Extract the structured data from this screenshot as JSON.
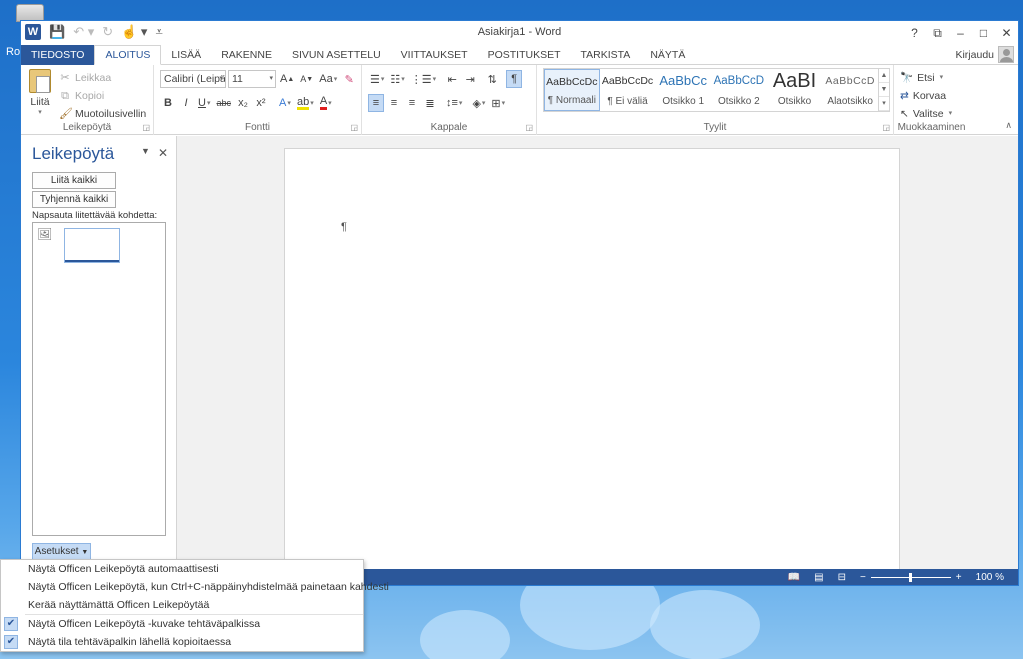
{
  "desktop": {
    "fragment": "Ro"
  },
  "window": {
    "title": "Asiakirja1 - Word",
    "controls": [
      "?",
      "⧉",
      "–",
      "□",
      "✕"
    ]
  },
  "tabs": {
    "items": [
      {
        "label": "TIEDOSTO"
      },
      {
        "label": "ALOITUS"
      },
      {
        "label": "LISÄÄ"
      },
      {
        "label": "RAKENNE"
      },
      {
        "label": "SIVUN ASETTELU"
      },
      {
        "label": "VIITTAUKSET"
      },
      {
        "label": "POSTITUKSET"
      },
      {
        "label": "TARKISTA"
      },
      {
        "label": "NÄYTÄ"
      }
    ],
    "signin": "Kirjaudu"
  },
  "ribbon": {
    "clipboard": {
      "label": "Leikepöytä",
      "paste": "Liitä",
      "cut": "Leikkaa",
      "copy": "Kopioi",
      "format_painter": "Muotoilusivellin"
    },
    "font": {
      "label": "Fontti",
      "font_name": "Calibri (Leipä",
      "font_size": "11",
      "grow": "A",
      "shrink": "A",
      "change_case": "Aa",
      "bold": "B",
      "italic": "I",
      "underline": "U",
      "strike": "abc",
      "subscript": "x₂",
      "superscript": "x²",
      "effects": "A",
      "font_color": "A",
      "highlight_color": "#f0e200",
      "font_color_value": "#e02020"
    },
    "paragraph": {
      "label": "Kappale",
      "pilcrow": "¶"
    },
    "styles": {
      "label": "Tyylit",
      "items": [
        {
          "sample": "AaBbCcDc",
          "name": "¶ Normaali"
        },
        {
          "sample": "AaBbCcDc",
          "name": "¶ Ei väliä"
        },
        {
          "sample": "AaBbCc",
          "name": "Otsikko 1"
        },
        {
          "sample": "AaBbCcD",
          "name": "Otsikko 2"
        },
        {
          "sample": "AaBI",
          "name": "Otsikko"
        },
        {
          "sample": "AaBbCcD",
          "name": "Alaotsikko"
        }
      ]
    },
    "editing": {
      "label": "Muokkaaminen",
      "find": "Etsi",
      "replace": "Korvaa",
      "select": "Valitse"
    }
  },
  "taskpane": {
    "title": "Leikepöytä",
    "paste_all": "Liitä kaikki",
    "clear_all": "Tyhjennä kaikki",
    "hint": "Napsauta liitettävää kohdetta:",
    "options_button": "Asetukset"
  },
  "document": {
    "pilcrow": "¶"
  },
  "status": {
    "zoom": "100 %"
  },
  "options_menu": {
    "items": [
      {
        "label": "Näytä Officen Leikepöytä automaattisesti",
        "checked": false
      },
      {
        "label": "Näytä Officen Leikepöytä, kun Ctrl+C-näppäinyhdistelmää painetaan kahdesti",
        "checked": false
      },
      {
        "label": "Kerää näyttämättä Officen Leikepöytää",
        "checked": false
      },
      {
        "label": "Näytä Officen Leikepöytä -kuvake tehtäväpalkissa",
        "checked": true
      },
      {
        "label": "Näytä tila tehtäväpalkin lähellä kopioitaessa",
        "checked": true
      }
    ]
  },
  "colors": {
    "accent": "#2b579a",
    "selection": "#c5dbf5",
    "desktop": "#2b86dd"
  }
}
